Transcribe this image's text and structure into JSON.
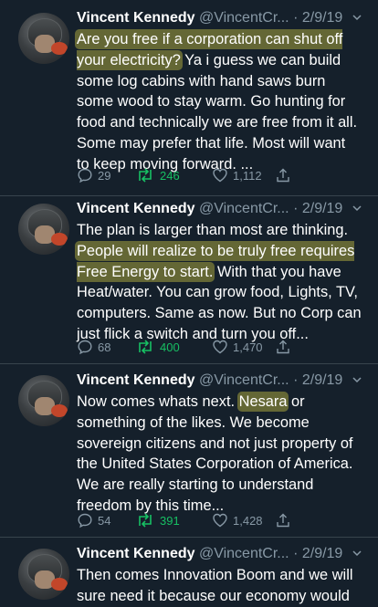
{
  "tweets": [
    {
      "name": "Vincent Kennedy",
      "handle": "@VincentCr...",
      "sep": " · ",
      "date": "2/9/19",
      "text": [
        {
          "t": "Are you free if a corporation can shut off your electricity?",
          "hl": true
        },
        {
          "t": " Ya i guess we can build some log cabins with hand saws burn some wood to stay warm. Go hunting for food and technically we are free from it all. Some may prefer that life. Most will want to keep moving forward. ...",
          "hl": false
        }
      ],
      "replies": "29",
      "retweets": "246",
      "likes": "1,112"
    },
    {
      "name": "Vincent Kennedy",
      "handle": "@VincentCr...",
      "sep": " · ",
      "date": "2/9/19",
      "text": [
        {
          "t": "The plan is larger than most are thinking. ",
          "hl": false
        },
        {
          "t": "People will realize to be truly free requires Free Energy to start.",
          "hl": true
        },
        {
          "t": " With that you have Heat/water. You can grow food, Lights, TV, computers. Same as now. But no Corp can just flick a switch and turn you off...",
          "hl": false
        }
      ],
      "replies": "68",
      "retweets": "400",
      "likes": "1,470"
    },
    {
      "name": "Vincent Kennedy",
      "handle": "@VincentCr...",
      "sep": " · ",
      "date": "2/9/19",
      "text": [
        {
          "t": "Now comes whats next. ",
          "hl": false
        },
        {
          "t": "Nesara",
          "hl": true
        },
        {
          "t": " or something of the likes. We become sovereign citizens and not just property of the United States Corporation of America. We are really starting to understand freedom by this time...",
          "hl": false
        }
      ],
      "replies": "54",
      "retweets": "391",
      "likes": "1,428"
    },
    {
      "name": "Vincent Kennedy",
      "handle": "@VincentCr...",
      "sep": " · ",
      "date": "2/9/19",
      "text": [
        {
          "t": "Then comes Innovation Boom and we will sure need it because our economy would",
          "hl": false
        }
      ],
      "replies": "",
      "retweets": "",
      "likes": ""
    }
  ],
  "icons": {
    "avatar": "avatar-helmet-icon",
    "more": "chevron-down-icon",
    "reply": "reply-icon",
    "retweet": "retweet-icon",
    "like": "heart-icon",
    "share": "share-icon"
  },
  "colors": {
    "background": "#15202b",
    "secondary_text": "#8899a6",
    "retweet_active": "#17bf63",
    "highlight": "#e6de48"
  }
}
